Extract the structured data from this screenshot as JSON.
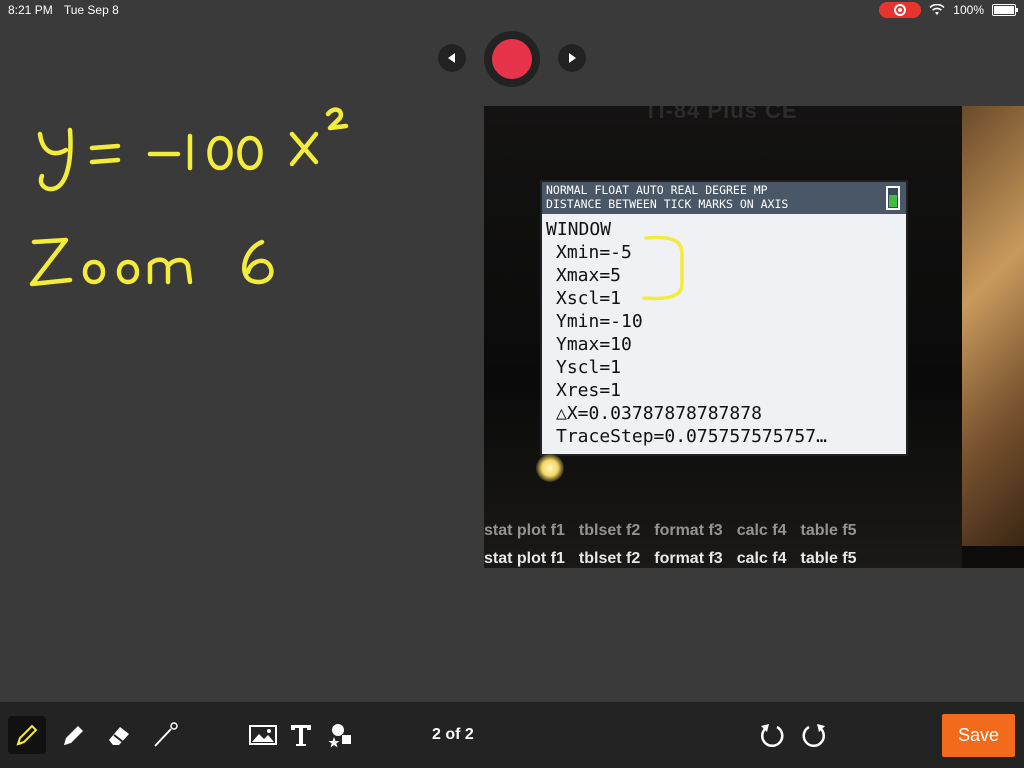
{
  "status_bar": {
    "time": "8:21 PM",
    "date": "Tue Sep 8",
    "battery": "100%"
  },
  "slide_nav": {
    "prev_icon": "prev-triangle-icon",
    "next_icon": "next-triangle-icon",
    "record_color": "#e8344a"
  },
  "whiteboard": {
    "ink_color": "#f4ec3a",
    "lines": [
      "y = −100 x²",
      "Zoom 6"
    ]
  },
  "calculator": {
    "brand": "TI-84 Plus CE",
    "header_line1": "NORMAL FLOAT AUTO REAL DEGREE MP",
    "header_line2": "DISTANCE BETWEEN TICK MARKS ON AXIS",
    "window_title": "WINDOW",
    "window_lines": [
      "Xmin=-5",
      "Xmax=5",
      "Xscl=1",
      "Ymin=-10",
      "Ymax=10",
      "Yscl=1",
      "Xres=1",
      "△X=0.03787878787878",
      "TraceStep=0.075757575757…"
    ],
    "function_keys_row1": [
      "stat plot f1",
      "tblset f2",
      "format f3",
      "calc f4",
      "table f5"
    ],
    "function_keys_row2": [
      "stat plot f1",
      "tblset f2",
      "format f3",
      "calc f4",
      "table f5"
    ]
  },
  "toolbar": {
    "tools": [
      "pencil-icon",
      "marker-icon",
      "eraser-icon",
      "laser-pointer-icon",
      "image-icon",
      "text-icon",
      "shapes-icon"
    ],
    "page_indicator": "2 of 2",
    "undo_icon": "undo-icon",
    "redo_icon": "redo-icon",
    "save_label": "Save",
    "save_color": "#f26b1d"
  }
}
